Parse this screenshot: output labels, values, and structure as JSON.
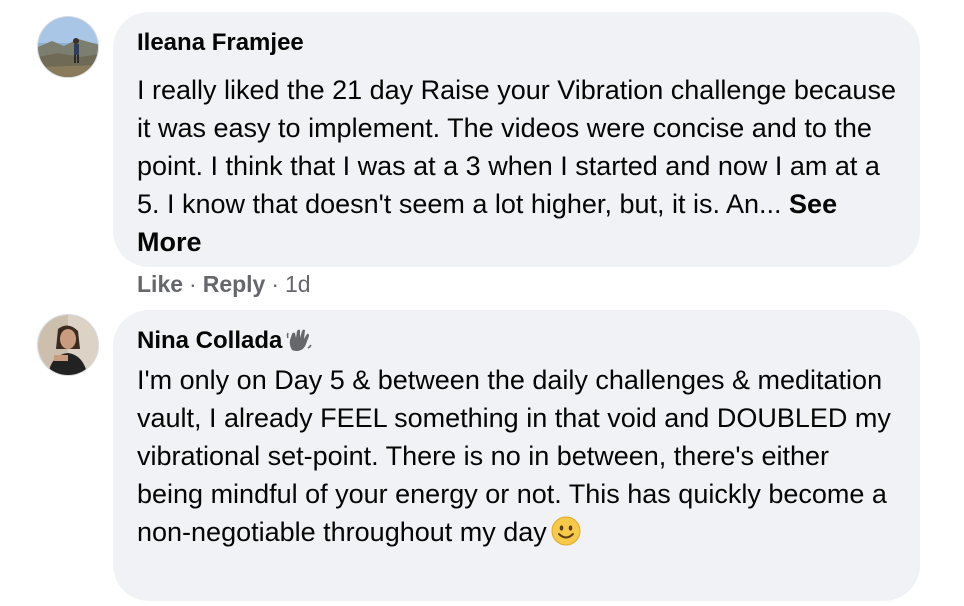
{
  "comments": [
    {
      "author": "Ileana Framjee",
      "text": "I really liked the 21 day Raise your Vibration challenge because it was easy to implement. The videos were concise and to the point. I think that I was at a 3 when I started and now I am at a 5. I know that doesn't seem a lot higher, but, it is. An...",
      "see_more": "See More",
      "actions": {
        "like": "Like",
        "reply": "Reply",
        "time": "1d",
        "separator": "·"
      }
    },
    {
      "author": "Nina Collada",
      "badge_icon": "waving-hand-badge-icon",
      "text": "I'm only on Day 5 & between the daily challenges & meditation vault, I already FEEL something in that void and DOUBLED my vibrational set-point. There is no in between, there's either being mindful of your energy or not. This has quickly become a non-negotiable throughout my day",
      "emoji_icon": "smiling-face-emoji-icon"
    }
  ],
  "colors": {
    "bubble": "#f0f2f5",
    "text": "#050505",
    "secondary": "#65676b"
  }
}
